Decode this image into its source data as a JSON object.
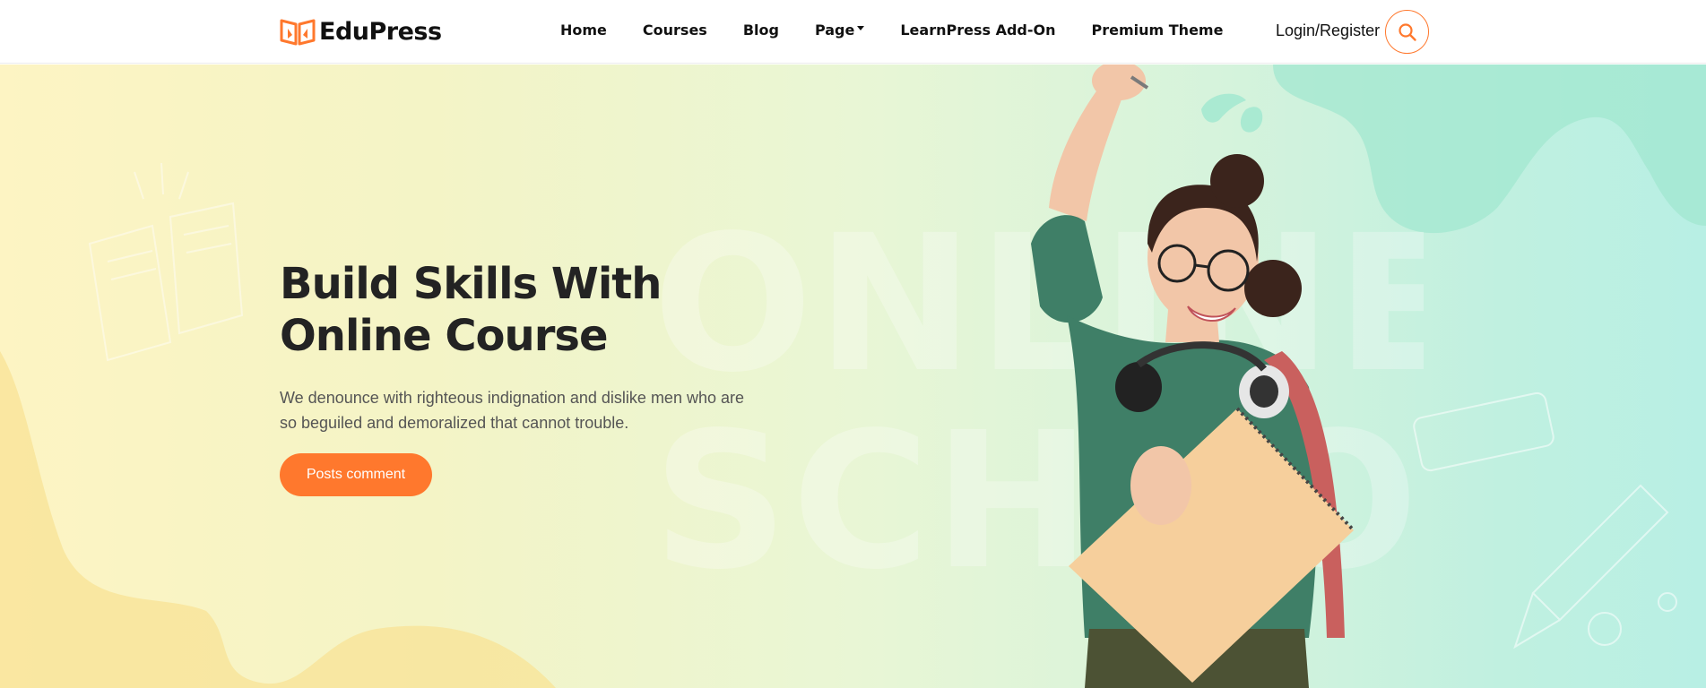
{
  "header": {
    "brand": "EduPress",
    "logo_icon": "open-book-logo-icon",
    "nav": [
      {
        "label": "Home"
      },
      {
        "label": "Courses"
      },
      {
        "label": "Blog"
      },
      {
        "label": "Page",
        "has_dropdown": true
      },
      {
        "label": "LearnPress Add-On"
      },
      {
        "label": "Premium Theme"
      }
    ],
    "login_label": "Login/Register",
    "search_icon": "search-icon"
  },
  "hero": {
    "title_line1": "Build Skills With",
    "title_line2": "Online Course",
    "description": "We denounce with righteous indignation and dislike men who are so beguiled and demoralized that cannot trouble.",
    "cta_label": "Posts comment",
    "watermark_text_1": "ONLINE",
    "watermark_text_2": "SCHOOL"
  },
  "colors": {
    "accent": "#ff782d",
    "text_dark": "#232323",
    "text_muted": "#555555",
    "sweater_green": "#3f7f67",
    "notebook": "#f6cf9c"
  }
}
